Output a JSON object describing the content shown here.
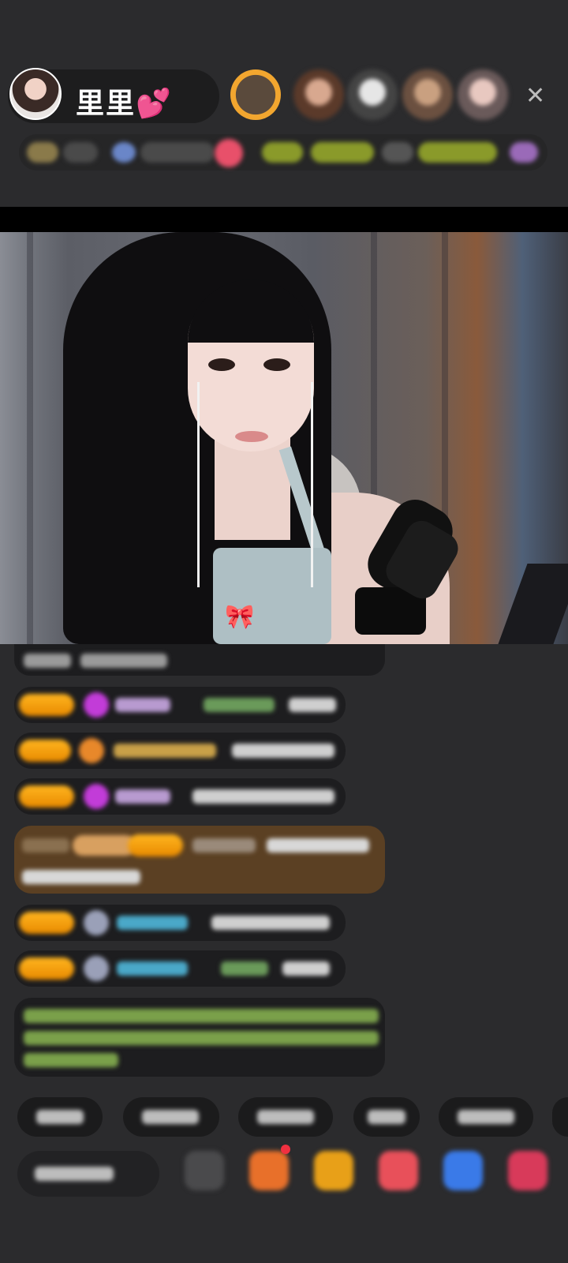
{
  "host": {
    "name": "里里💕",
    "avatar_icon": "host-avatar",
    "close_icon": "close-icon"
  },
  "top_fans": [
    "fan-avatar-1",
    "fan-avatar-2",
    "fan-avatar-3",
    "fan-avatar-4",
    "fan-avatar-5"
  ],
  "colors": {
    "badge": "#f5a000",
    "chat_bg": "#1c1c1e",
    "highlight_bg": "#5b4023",
    "page_bg": "#2b2b2d"
  },
  "bottom_tools": [
    "more-icon",
    "gift-box-icon",
    "red-packet-icon",
    "pink-gift-icon",
    "blue-gift-icon",
    "shop-icon"
  ]
}
